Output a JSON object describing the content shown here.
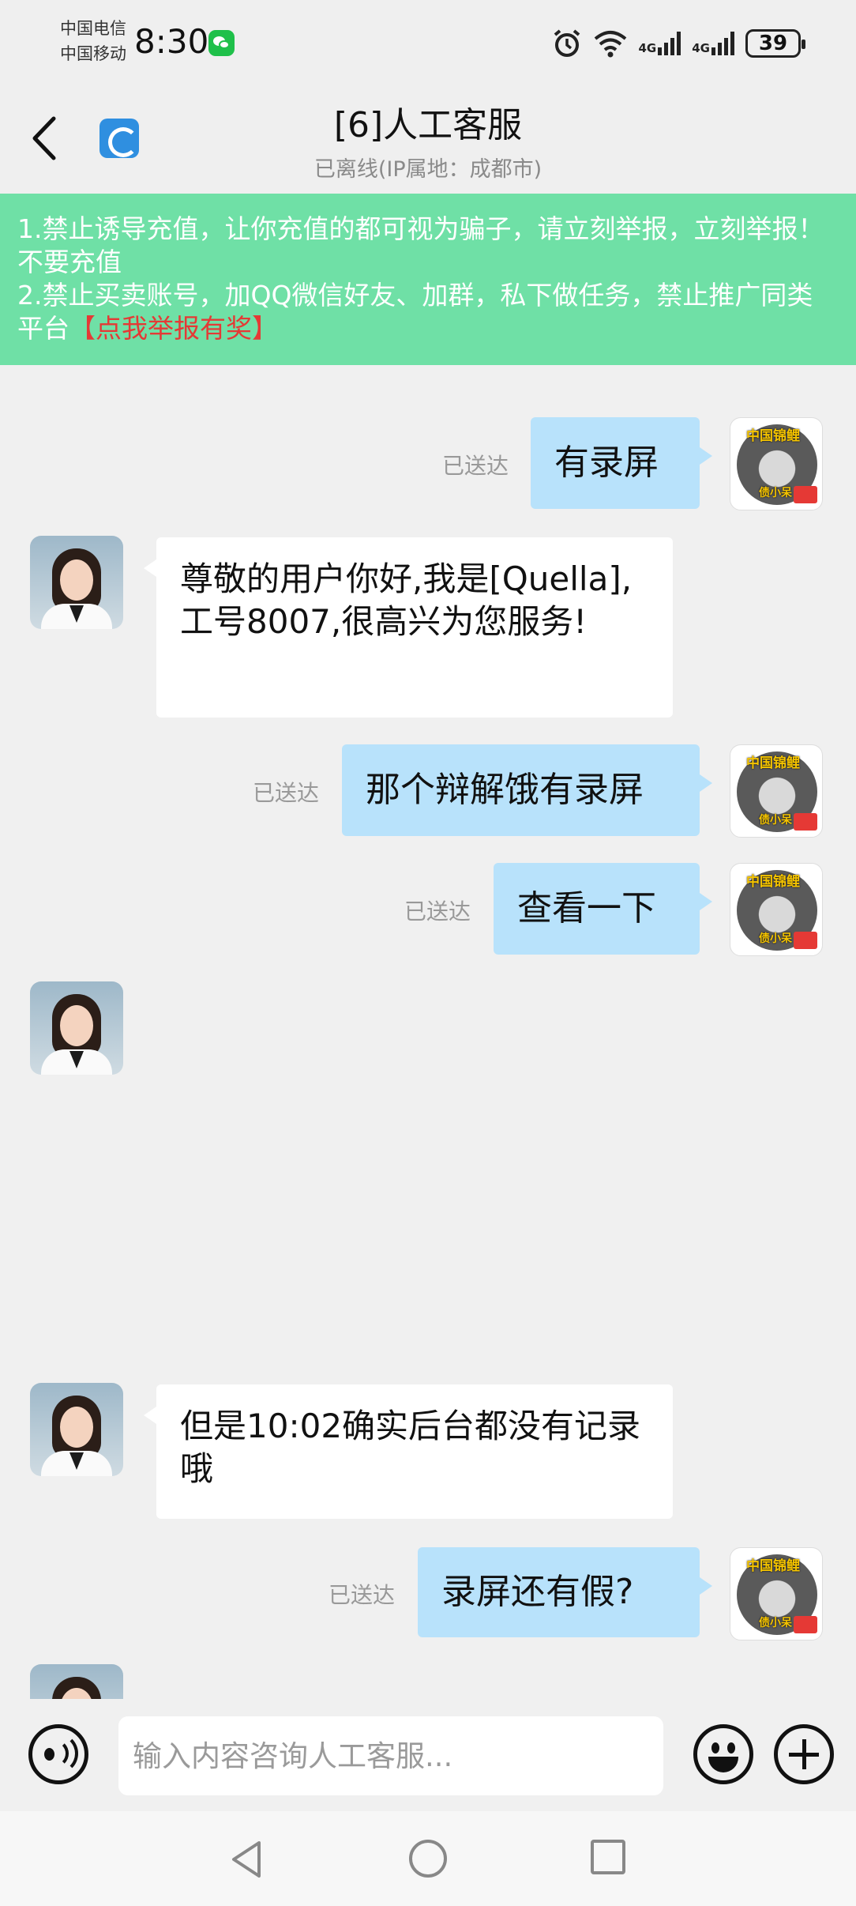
{
  "status_bar": {
    "carrier_1": "中国电信",
    "carrier_2": "中国移动",
    "time": "8:30",
    "network_1": "4G",
    "network_2": "4G",
    "battery": "39",
    "icons": [
      "wechat-icon",
      "alarm-icon",
      "wifi-icon",
      "signal-icon",
      "battery-icon"
    ]
  },
  "header": {
    "title": "[6]人工客服",
    "subtitle": "已离线(IP属地：成都市)"
  },
  "notice": {
    "line_1": "1.禁止诱导充值，让你充值的都可视为骗子，请立刻举报，立刻举报！不要充值",
    "line_2": "2.禁止买卖账号，加QQ微信好友、加群，私下做任务，禁止推广同类平台",
    "report_link": "【点我举报有奖】"
  },
  "user_avatar": {
    "badge_top": "中国锦鲤",
    "badge_bottom": "债小呆"
  },
  "messages": [
    {
      "from": "me",
      "text": "有录屏",
      "status": "已送达"
    },
    {
      "from": "agent",
      "text": "尊敬的用户你好,我是[Quella],工号8007,很高兴为您服务!"
    },
    {
      "from": "me",
      "text": "那个辩解饿有录屏",
      "status": "已送达"
    },
    {
      "from": "me",
      "text": "查看一下",
      "status": "已送达"
    },
    {
      "from": "agent",
      "text": ""
    },
    {
      "from": "agent",
      "text": "但是10:02确实后台都没有记录哦"
    },
    {
      "from": "me",
      "text": "录屏还有假?",
      "status": "已送达"
    }
  ],
  "input": {
    "placeholder": "输入内容咨询人工客服...",
    "value": ""
  },
  "colors": {
    "notice_bg": "#6fe0a6",
    "my_bubble": "#b8e2fb",
    "agent_bubble": "#ffffff",
    "report_link": "#e53935",
    "background": "#f0f0f0"
  }
}
